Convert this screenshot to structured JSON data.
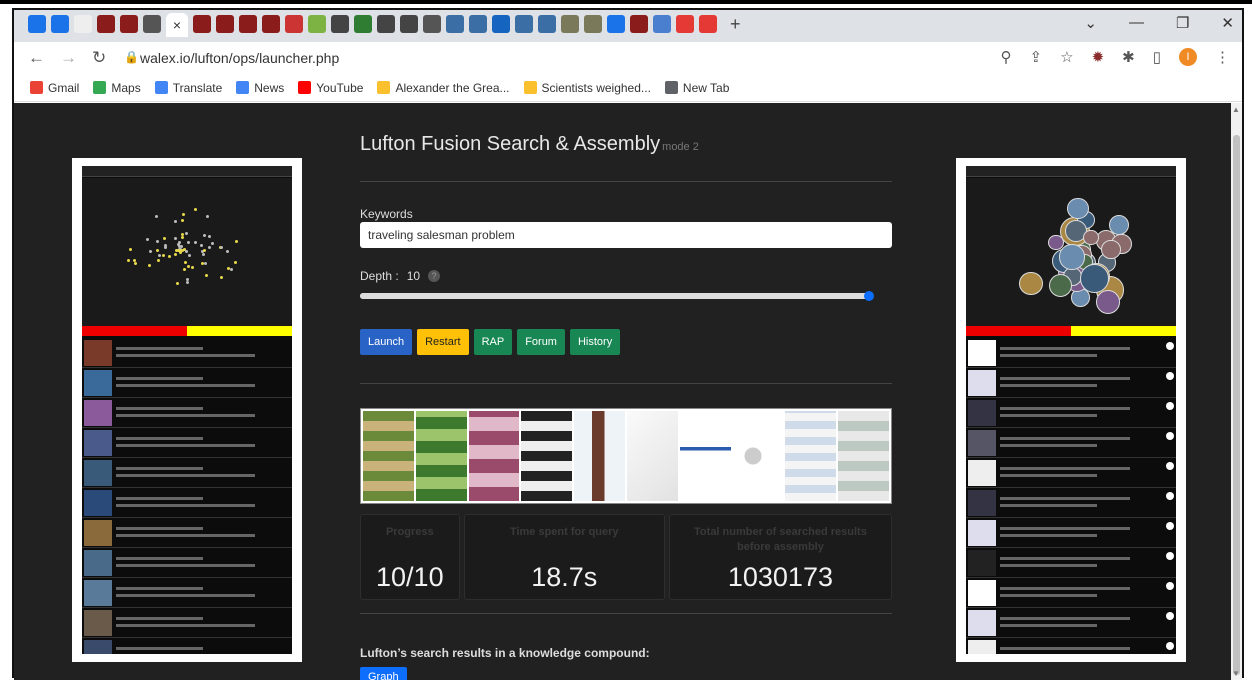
{
  "browser": {
    "tabs_count": 40,
    "active_tab_close": "×",
    "new_tab": "+",
    "url": "walex.io/lufton/ops/launcher.php",
    "profile_initial": "I"
  },
  "bookmarks": [
    {
      "label": "Gmail",
      "icon": "gmail-icon",
      "color": "#ea4335"
    },
    {
      "label": "Maps",
      "icon": "maps-icon",
      "color": "#34a853"
    },
    {
      "label": "Translate",
      "icon": "translate-icon",
      "color": "#4285f4"
    },
    {
      "label": "News",
      "icon": "news-icon",
      "color": "#4285f4"
    },
    {
      "label": "YouTube",
      "icon": "youtube-icon",
      "color": "#ff0000"
    },
    {
      "label": "Alexander the Grea...",
      "icon": "bookmark-page-icon",
      "color": "#fbc02d"
    },
    {
      "label": "Scientists weighed...",
      "icon": "bookmark-page-icon",
      "color": "#fbc02d"
    },
    {
      "label": "New Tab",
      "icon": "globe-icon",
      "color": "#5f6368"
    }
  ],
  "app": {
    "title": "Lufton Fusion Search & Assembly",
    "mode": "mode 2",
    "keywords_label": "Keywords",
    "keywords_value": "traveling salesman problem",
    "depth_label": "Depth :",
    "depth_value": "10",
    "depth_help": "?",
    "depth_fraction": 1.0,
    "buttons": {
      "launch": "Launch",
      "restart": "Restart",
      "rap": "RAP",
      "forum": "Forum",
      "history": "History"
    },
    "stats": {
      "progress_label": "Progress",
      "progress_value": "10/10",
      "time_label": "Time spent for query",
      "time_value": "18.7s",
      "total_label": "Total number of searched results before assembly",
      "total_value": "1030173"
    },
    "compound_text": "Lufton’s search results in a knowledge compound:",
    "graph_button": "Graph"
  },
  "colors": {
    "page_bg": "#212121",
    "launch": "#2a63c6",
    "restart": "#ffc107",
    "green": "#198754",
    "graph": "#0d6efd"
  }
}
